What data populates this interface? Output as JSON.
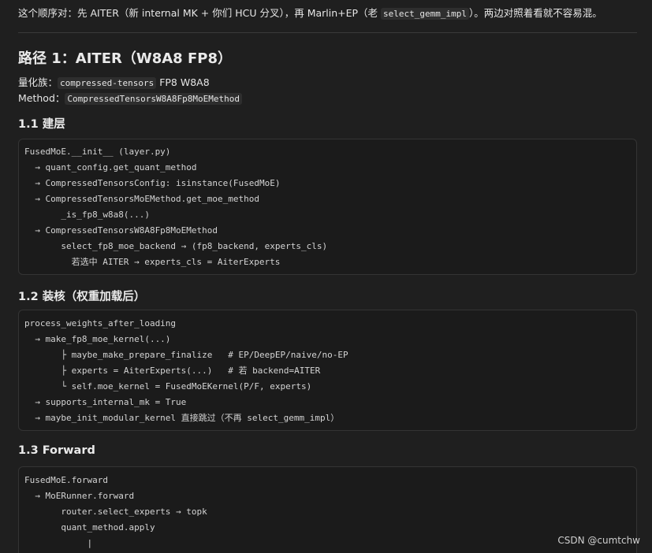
{
  "intro": {
    "before": "这个顺序对：先 AITER（新 internal MK + 你们 HCU 分叉），再 Marlin+EP（老 ",
    "code": "select_gemm_impl",
    "after": "）。两边对照着看就不容易混。"
  },
  "section": {
    "title": "路径 1：AITER（W8A8 FP8）",
    "quant_family_label": "量化族：",
    "quant_family_code": "compressed-tensors",
    "quant_family_suffix": " FP8 W8A8",
    "method_label": "Method：",
    "method_code": "CompressedTensorsW8A8Fp8MoEMethod"
  },
  "subsections": [
    {
      "title": "1.1 建层",
      "lines": [
        "FusedMoE.__init__ (layer.py)",
        "  → quant_config.get_quant_method",
        "  → CompressedTensorsConfig: isinstance(FusedMoE)",
        "  → CompressedTensorsMoEMethod.get_moe_method",
        "       _is_fp8_w8a8(...)",
        "  → CompressedTensorsW8A8Fp8MoEMethod",
        "       select_fp8_moe_backend → (fp8_backend, experts_cls)",
        "         若选中 AITER → experts_cls = AiterExperts"
      ]
    },
    {
      "title": "1.2 装核（权重加载后）",
      "lines": [
        "process_weights_after_loading",
        "  → make_fp8_moe_kernel(...)",
        "       ├ maybe_make_prepare_finalize   # EP/DeepEP/naive/no-EP",
        "       ├ experts = AiterExperts(...)   # 若 backend=AITER",
        "       └ self.moe_kernel = FusedMoEKernel(P/F, experts)",
        "  → supports_internal_mk = True",
        "  → maybe_init_modular_kernel 直接跳过（不再 select_gemm_impl）"
      ]
    },
    {
      "title": "1.3 Forward",
      "lines": [
        "FusedMoE.forward",
        "  → MoERunner.forward",
        "       router.select_experts → topk",
        "       quant_method.apply",
        "            |"
      ]
    }
  ],
  "watermark": "CSDN @cumtchw"
}
